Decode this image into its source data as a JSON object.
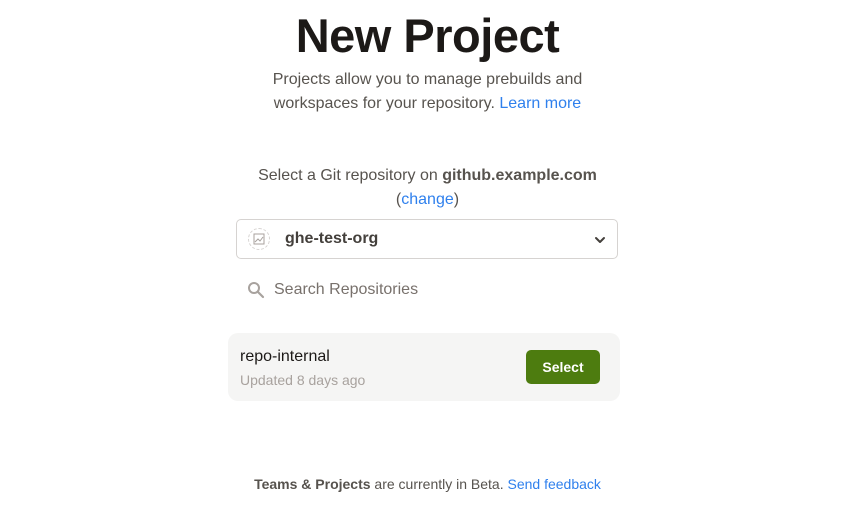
{
  "header": {
    "title": "New Project",
    "subtitle_line1": "Projects allow you to manage prebuilds and",
    "subtitle_line2": "workspaces for your repository.",
    "learn_more": "Learn more"
  },
  "git": {
    "prefix": "Select a Git repository on ",
    "host": "github.example.com",
    "change_open": "(",
    "change_label": "change",
    "change_close": ")"
  },
  "org_selector": {
    "value": "ghe-test-org",
    "avatar_icon": "broken-image-icon",
    "chevron_icon": "chevron-down-icon"
  },
  "search": {
    "placeholder": "Search Repositories",
    "value": "",
    "icon": "search-icon"
  },
  "repos": [
    {
      "name": "repo-internal",
      "updated": "Updated 8 days ago",
      "action": "Select"
    }
  ],
  "footer": {
    "strong": "Teams & Projects",
    "text": " are currently in Beta. ",
    "link": "Send feedback"
  },
  "colors": {
    "accent_link": "#2f80ed",
    "select_button": "#4d7c0f",
    "card_bg": "#f5f5f4"
  }
}
